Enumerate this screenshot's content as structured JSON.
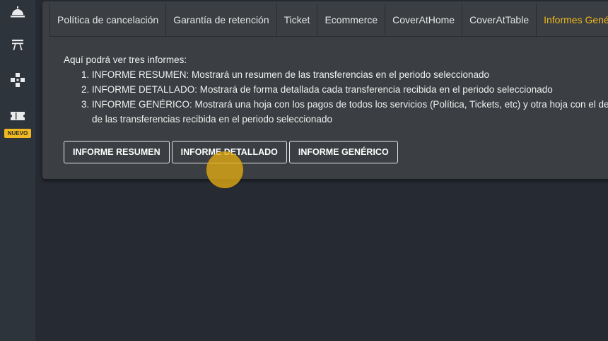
{
  "sidebar": {
    "badge": "NUEVO",
    "icons": [
      "bell-service-icon",
      "table-icon",
      "puzzle-icon",
      "ticket-icon"
    ]
  },
  "tabs": [
    {
      "label": "Política de cancelación"
    },
    {
      "label": "Garantía de retención"
    },
    {
      "label": "Ticket"
    },
    {
      "label": "Ecommerce"
    },
    {
      "label": "CoverAtHome"
    },
    {
      "label": "CoverAtTable"
    },
    {
      "label": "Informes Gené",
      "active": true
    }
  ],
  "content": {
    "intro": "Aquí podrá ver tres informes:",
    "items": [
      "INFORME RESUMEN: Mostrará un resumen de las transferencias en el periodo seleccionado",
      "INFORME DETALLADO: Mostrará de forma detallada cada transferencia recibida en el periodo seleccionado",
      "INFORME GENÉRICO: Mostrará una hoja con los pagos de todos los servicios (Política, Tickets, etc) y otra hoja con el detalle de las transferencias recibida en el periodo seleccionado"
    ]
  },
  "buttons": {
    "resumen": "INFORME RESUMEN",
    "detallado": "INFORME DETALLADO",
    "generico": "INFORME GENÉRICO"
  },
  "colors": {
    "accent": "#f0b820",
    "background": "#262b33",
    "panel": "#3b3e42",
    "sidebar": "#2e343b"
  }
}
